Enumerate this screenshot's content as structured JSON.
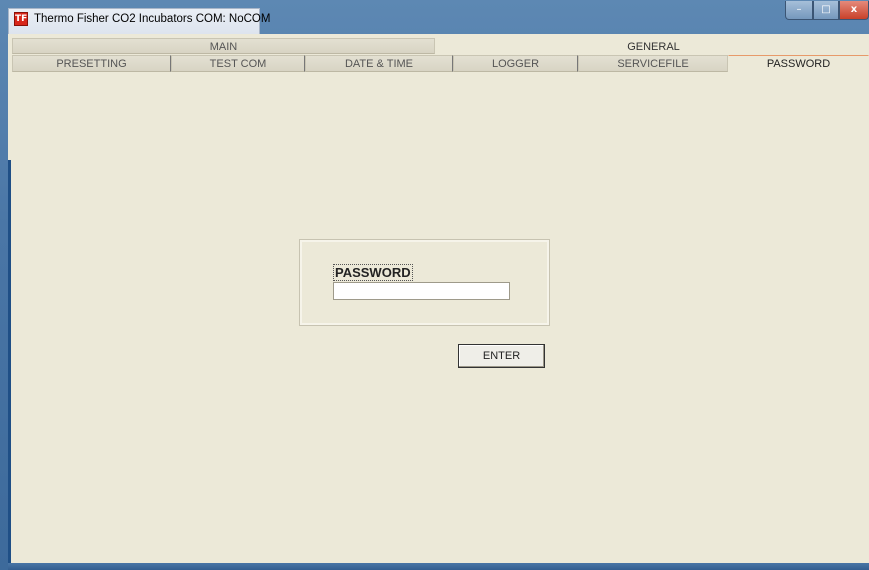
{
  "window": {
    "title": "Thermo Fisher CO2 Incubators COM: NoCOM",
    "icon": "TF",
    "controls": {
      "minimize": "–",
      "maximize": "□",
      "close": "x"
    }
  },
  "tabs_top": [
    {
      "label": "MAIN"
    },
    {
      "label": "GENERAL"
    }
  ],
  "tabs_sub": [
    {
      "label": "PRESETTING"
    },
    {
      "label": "TEST COM"
    },
    {
      "label": "DATE & TIME"
    },
    {
      "label": "LOGGER"
    },
    {
      "label": "SERVICEFILE"
    },
    {
      "label": "PASSWORD"
    }
  ],
  "password_panel": {
    "label": "PASSWORD",
    "value": "",
    "enter_label": "ENTER"
  }
}
